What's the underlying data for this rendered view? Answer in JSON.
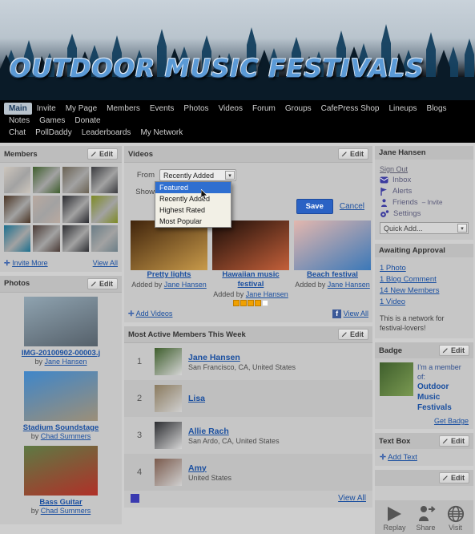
{
  "site": {
    "title": "OUTDOOR MUSIC FESTIVALS"
  },
  "nav": {
    "row1": [
      {
        "label": "Main",
        "active": true
      },
      {
        "label": "Invite"
      },
      {
        "label": "My Page"
      },
      {
        "label": "Members"
      },
      {
        "label": "Events"
      },
      {
        "label": "Photos"
      },
      {
        "label": "Videos"
      },
      {
        "label": "Forum"
      },
      {
        "label": "Groups"
      },
      {
        "label": "CafePress Shop"
      },
      {
        "label": "Lineups"
      },
      {
        "label": "Blogs"
      },
      {
        "label": "Notes"
      },
      {
        "label": "Games"
      },
      {
        "label": "Donate"
      }
    ],
    "row2": [
      {
        "label": "Chat"
      },
      {
        "label": "PollDaddy"
      },
      {
        "label": "Leaderboards"
      },
      {
        "label": "My Network"
      }
    ]
  },
  "common": {
    "edit_label": "Edit",
    "view_all": "View All"
  },
  "members_module": {
    "title": "Members",
    "edit_label": "Edit",
    "invite_more": "Invite More",
    "view_all": "View All",
    "avatars": [
      "#cdc6bd",
      "#3e5e2c",
      "#6a6253",
      "#3a3b3f",
      "#4a3424",
      "#b9a9a0",
      "#2a2b30",
      "#7d8a24",
      "#1b6f8e",
      "#4a3a35",
      "#2e2f33",
      "#6a7d86"
    ]
  },
  "photos_module": {
    "title": "Photos",
    "edit_label": "Edit",
    "items": [
      {
        "caption": "IMG-20100902-00003.j",
        "by_prefix": "by ",
        "author": "Jane Hansen",
        "color1": "#8fa3b0",
        "color2": "#55606a"
      },
      {
        "caption": "Stadium Soundstage",
        "by_prefix": "by ",
        "author": "Chad Summers",
        "color1": "#3f86c9",
        "color2": "#9c8f78"
      },
      {
        "caption": "Bass Guitar",
        "by_prefix": "by ",
        "author": "Chad Summers",
        "color1": "#5d7a44",
        "color2": "#b03028"
      }
    ]
  },
  "videos_module": {
    "title": "Videos",
    "edit_label": "Edit",
    "from_label": "From",
    "show_label": "Show",
    "from_value": "Recently Added",
    "dropdown_options": [
      {
        "label": "Featured",
        "selected": true
      },
      {
        "label": "Recently Added",
        "selected": false
      },
      {
        "label": "Highest Rated",
        "selected": false
      },
      {
        "label": "Most Popular",
        "selected": false
      }
    ],
    "save_label": "Save",
    "cancel_label": "Cancel",
    "add_videos": "Add Videos",
    "view_all": "View All",
    "items": [
      {
        "title": "Pretty lights",
        "added_by_prefix": "Added by ",
        "author": "Jane Hansen",
        "rating": 0,
        "color1": "#40240c",
        "color2": "#c89a4a"
      },
      {
        "title": "Hawaiian music festival",
        "added_by_prefix": "Added by ",
        "author": "Jane Hansen",
        "rating": 4,
        "color1": "#1a0d08",
        "color2": "#c4603a"
      },
      {
        "title": "Beach festival",
        "added_by_prefix": "Added by ",
        "author": "Jane Hansen",
        "rating": 0,
        "color1": "#e3b7ae",
        "color2": "#3b78b8"
      }
    ]
  },
  "active_members": {
    "title": "Most Active Members This Week",
    "edit_label": "Edit",
    "view_all": "View All",
    "rows": [
      {
        "rank": "1",
        "name": "Jane Hansen",
        "location": "San Francisco, CA, United States",
        "color": "#3e5e2c"
      },
      {
        "rank": "2",
        "name": "Lisa",
        "location": "",
        "color": "#8a7a5e"
      },
      {
        "rank": "3",
        "name": "Allie Rach",
        "location": "San Ardo, CA, United States",
        "color": "#2b2c30"
      },
      {
        "rank": "4",
        "name": "Amy",
        "location": "United States",
        "color": "#7a5a4c"
      }
    ]
  },
  "user_panel": {
    "name": "Jane Hansen",
    "sign_out": "Sign Out",
    "links": [
      {
        "label": "Inbox",
        "icon": "envelope-icon"
      },
      {
        "label": "Alerts",
        "icon": "flag-icon"
      },
      {
        "label": "Friends",
        "suffix": " – Invite",
        "icon": "person-icon"
      },
      {
        "label": "Settings",
        "icon": "gear-icon"
      }
    ],
    "quick_add": "Quick Add..."
  },
  "approval": {
    "title": "Awaiting Approval",
    "items": [
      {
        "label": "1 Photo"
      },
      {
        "label": "1 Blog Comment"
      },
      {
        "label": "14 New Members"
      },
      {
        "label": "1 Video"
      }
    ],
    "blurb": "This is a network for festival-lovers!"
  },
  "badge": {
    "title": "Badge",
    "edit_label": "Edit",
    "line1": "I'm a member of:",
    "line2": "Outdoor Music Festivals",
    "get_badge": "Get Badge"
  },
  "textbox": {
    "title": "Text Box",
    "edit_label": "Edit",
    "add_text": "Add Text"
  },
  "player": {
    "edit_label": "Edit",
    "buttons": [
      {
        "label": "Replay",
        "icon": "play-icon"
      },
      {
        "label": "Share",
        "icon": "share-icon"
      },
      {
        "label": "Visit",
        "icon": "globe-icon"
      }
    ]
  }
}
